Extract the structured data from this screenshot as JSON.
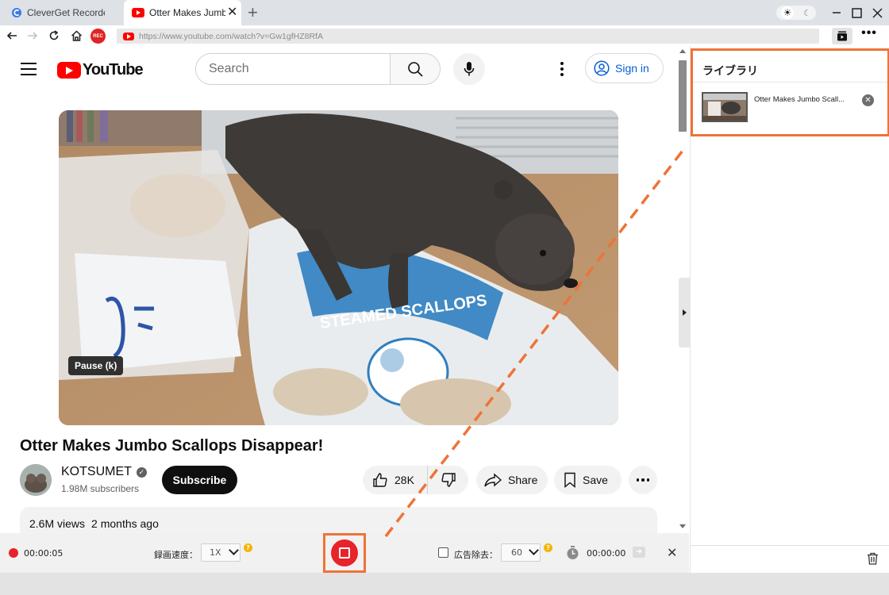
{
  "tabs": [
    {
      "title": "CleverGet Recorde",
      "active": false
    },
    {
      "title": "Otter Makes Jumbo",
      "active": true
    }
  ],
  "new_tab_symbol": "+",
  "address": {
    "url": "https://www.youtube.com/watch?v=Gw1gfHZ8RfA",
    "rec_badge": "REC"
  },
  "youtube": {
    "logo_text": "YouTube",
    "search_placeholder": "Search",
    "sign_in": "Sign in",
    "pause_tooltip": "Pause (k)",
    "video_title": "Otter Makes Jumbo Scallops Disappear!",
    "channel_name": "KOTSUMET",
    "subscribers": "1.98M subscribers",
    "subscribe_label": "Subscribe",
    "likes": "28K",
    "share_label": "Share",
    "save_label": "Save",
    "views": "2.6M views",
    "posted": "2 months ago"
  },
  "library": {
    "title": "ライブラリ",
    "items": [
      {
        "title": "Otter Makes Jumbo Scall..."
      }
    ]
  },
  "recorder": {
    "elapsed": "00:00:05",
    "speed_label": "録画速度：",
    "speed_value": "1X",
    "ad_skip_label": "広告除去：",
    "ad_skip_value": "60",
    "timer": "00:00:00",
    "help_symbol": "?"
  },
  "colors": {
    "accent_highlight": "#ee7338",
    "record_red": "#e8232a",
    "youtube_red": "#ff0000",
    "link_blue": "#065fd4"
  }
}
